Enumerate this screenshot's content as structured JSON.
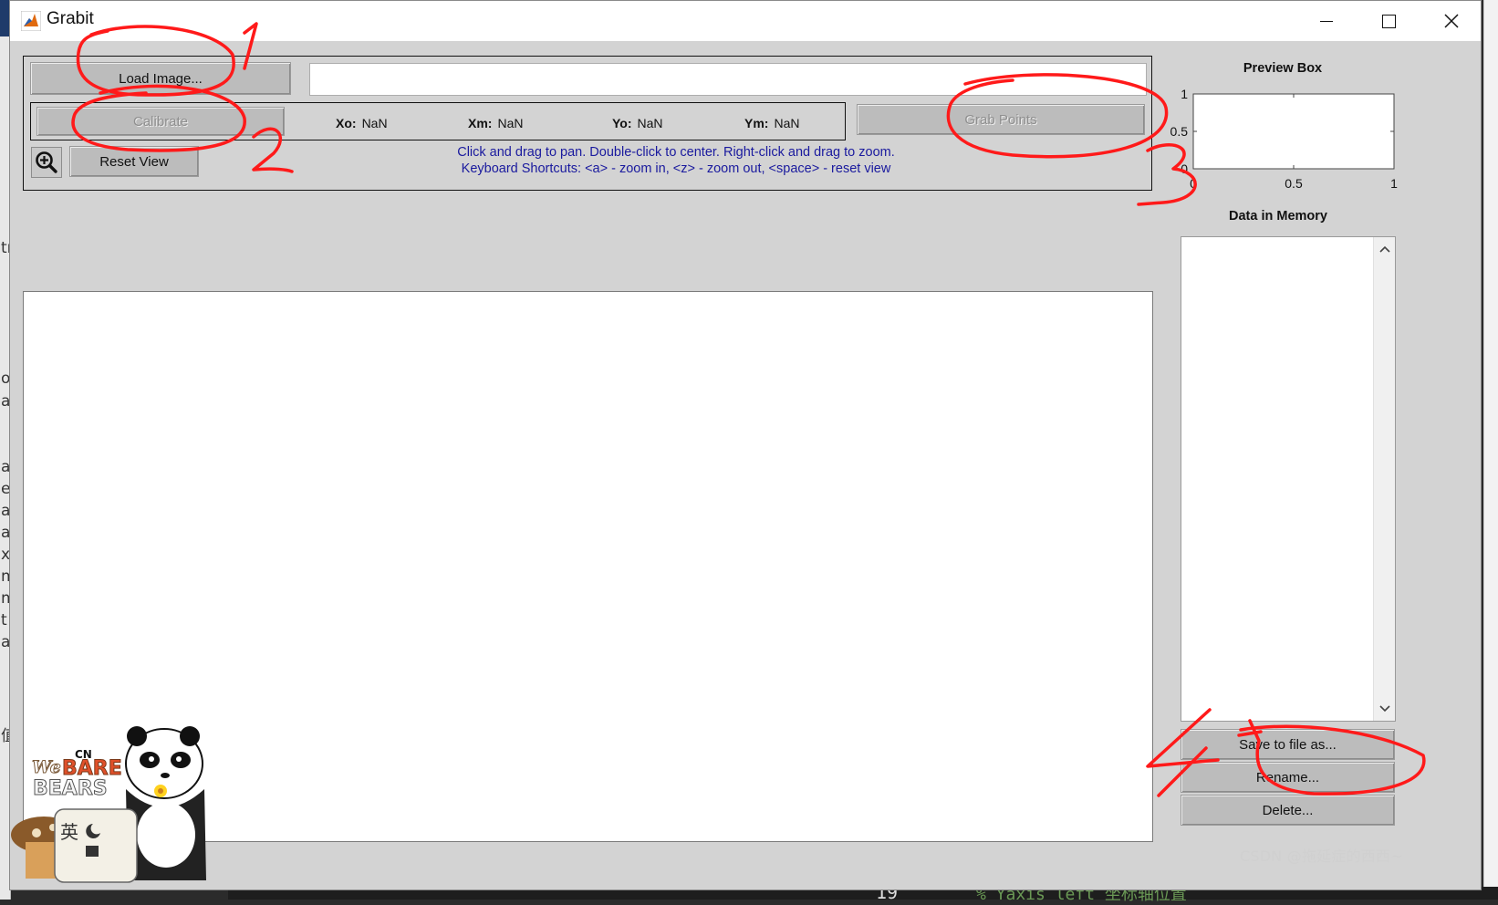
{
  "window": {
    "title": "Grabit"
  },
  "toolbar": {
    "load_image_label": "Load Image...",
    "image_path_value": "",
    "calibrate_label": "Calibrate",
    "grab_points_label": "Grab Points",
    "reset_view_label": "Reset View",
    "zoom_icon": "zoom-in-icon"
  },
  "calibration": {
    "xo_label": "Xo:",
    "xo_value": "NaN",
    "xm_label": "Xm:",
    "xm_value": "NaN",
    "yo_label": "Yo:",
    "yo_value": "NaN",
    "ym_label": "Ym:",
    "ym_value": "NaN"
  },
  "hints": {
    "line1": "Click and drag to pan. Double-click to center. Right-click and drag to zoom.",
    "line2": "Keyboard Shortcuts: <a> - zoom in, <z> - zoom out, <space> - reset view"
  },
  "preview": {
    "title": "Preview Box",
    "y_ticks": [
      "1",
      "0.5",
      "0"
    ],
    "x_ticks": [
      "0",
      "0.5",
      "1"
    ]
  },
  "memory": {
    "title": "Data in Memory",
    "items": [],
    "save_label": "Save to file as...",
    "rename_label": "Rename...",
    "delete_label": "Delete..."
  },
  "annotations": {
    "marks": [
      "1",
      "2",
      "3",
      "4"
    ]
  },
  "sticker": {
    "brand": "CN",
    "line1": "We",
    "line2": "BARE",
    "line3": "BEARS",
    "ime_char": "英"
  },
  "background": {
    "line_number": "19",
    "code_text": "% Yaxis left 坐标轴位置",
    "left_glyphs": [
      "tı",
      "o",
      "a",
      "a",
      "ex",
      "at",
      "al",
      "xe",
      "m",
      "m",
      "t",
      "a",
      "值"
    ]
  },
  "watermark": "CSDN @拖延症的西西~",
  "colors": {
    "hint_text": "#1a1a9e",
    "annotation": "#ff1a1a",
    "panel_bg": "#d3d3d3"
  }
}
